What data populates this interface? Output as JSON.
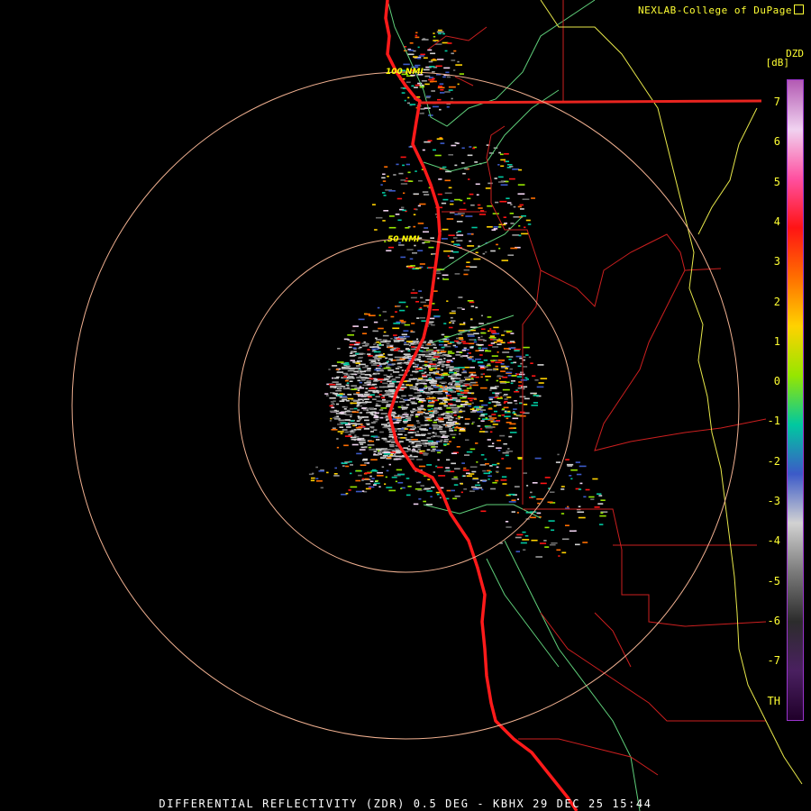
{
  "header": {
    "credit": "NEXLAB-College of DuPage"
  },
  "product": {
    "short_name": "DZD",
    "unit": "[dB]"
  },
  "rings": {
    "outer_label": "100 NMI",
    "inner_label": "50 NMI"
  },
  "colorbar": {
    "ticks": [
      "7",
      "6",
      "5",
      "4",
      "3",
      "2",
      "1",
      "0",
      "-1",
      "-2",
      "-3",
      "-4",
      "-5",
      "-6",
      "-7",
      "TH"
    ],
    "stops": [
      "#b35ab3",
      "#f0d2f0",
      "#ff50a0",
      "#ff1414",
      "#ff6e00",
      "#ffd200",
      "#96e600",
      "#00c8a0",
      "#3c5ac8",
      "#d2d2d2",
      "#7a7a7a",
      "#2c2c2c",
      "#4a2060",
      "#20002a"
    ]
  },
  "colors": {
    "background": "#000000",
    "coast": "#ff1a1a",
    "borders": "#cc1f1f",
    "counties": "#5fcf7a",
    "highways": "#e8e84a",
    "range_rings": "#f0b090",
    "label": "#ffff33"
  },
  "footer": {
    "caption": "DIFFERENTIAL REFLECTIVITY (ZDR) 0.5 DEG - KBHX 29 DEC 25 15:44"
  }
}
